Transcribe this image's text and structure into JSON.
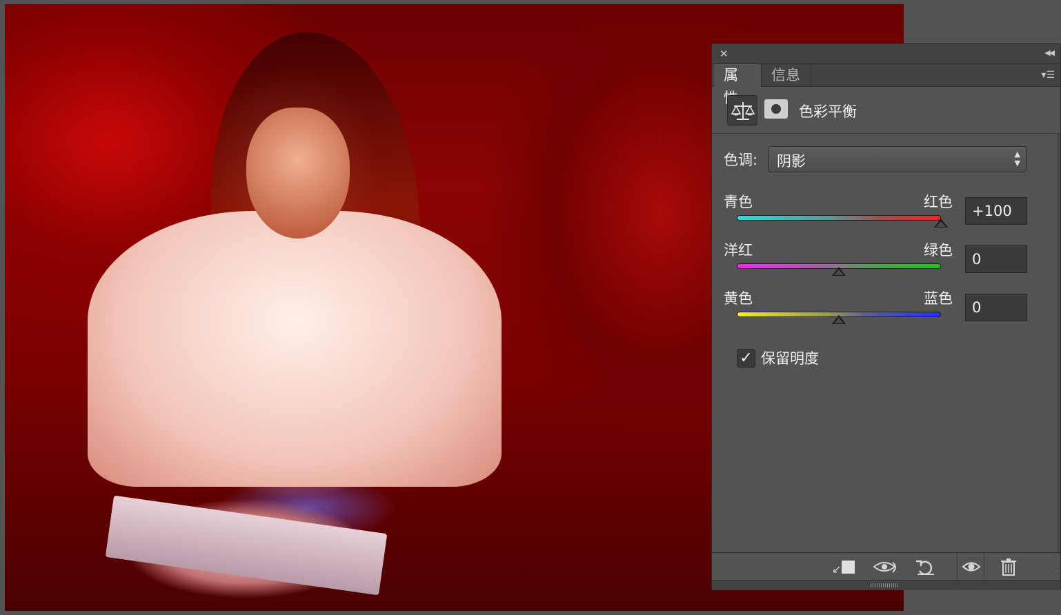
{
  "panel": {
    "close_glyph": "✕",
    "collapse_glyph": "◀◀",
    "menu_glyph": "▾☰",
    "tabs": [
      {
        "label": "属性",
        "active": true
      },
      {
        "label": "信息",
        "active": false
      }
    ],
    "adjustment_icon": "balance-scale-icon",
    "mask_icon": "layer-mask-icon",
    "adjustment_title": "色彩平衡"
  },
  "tone": {
    "label": "色调:",
    "value": "阴影",
    "arrows": "▲\n▼"
  },
  "sliders": [
    {
      "left_label": "青色",
      "right_label": "红色",
      "value": "+100",
      "position": 1.0,
      "gradient": [
        "#22e0e0",
        "#ff1e1e"
      ]
    },
    {
      "left_label": "洋红",
      "right_label": "绿色",
      "value": "0",
      "position": 0.5,
      "gradient": [
        "#ff20ff",
        "#10d010"
      ]
    },
    {
      "left_label": "黄色",
      "right_label": "蓝色",
      "value": "0",
      "position": 0.5,
      "gradient": [
        "#f0f020",
        "#2030ff"
      ]
    }
  ],
  "preserve_luminosity": {
    "label": "保留明度",
    "checked": true,
    "check_glyph": "✓"
  },
  "footer": {
    "clip_icon": "clip-to-layer-icon",
    "previous_state_icon": "view-previous-state-icon",
    "reset_icon": "reset-icon",
    "visibility_icon": "eye-icon",
    "delete_icon": "trash-icon"
  },
  "colors": {
    "panel_bg": "#535353",
    "tab_bar_bg": "#424242",
    "canvas_tint": "#8c0404"
  }
}
